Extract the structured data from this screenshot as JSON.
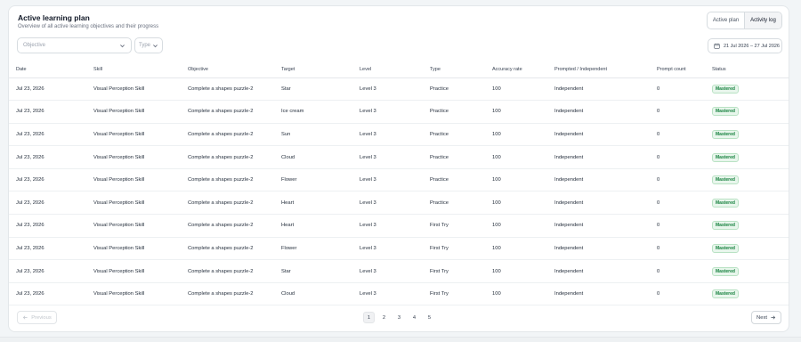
{
  "header": {
    "title": "Active learning plan",
    "subtitle": "Overview of all active learning objectives and their progress"
  },
  "view_toggle": {
    "items": [
      {
        "label": "Active plan",
        "active": false
      },
      {
        "label": "Activity log",
        "active": true
      }
    ]
  },
  "filters": {
    "objective_placeholder": "Objective",
    "type_placeholder": "Type",
    "date_range": "21 Jul 2026 – 27 Jul 2026"
  },
  "table": {
    "columns": [
      "Date",
      "Skill",
      "Objective",
      "Target",
      "Level",
      "Type",
      "Accuracy rate",
      "Prompted / Independent",
      "Prompt count",
      "Status"
    ],
    "rows": [
      [
        "Jul 23, 2026",
        "Visual Perception Skill",
        "Complete a shapes puzzle-2",
        "Star",
        "Level 3",
        "Practice",
        "100",
        "Independent",
        "0",
        "Mastered"
      ],
      [
        "Jul 23, 2026",
        "Visual Perception Skill",
        "Complete a shapes puzzle-2",
        "Ice cream",
        "Level 3",
        "Practice",
        "100",
        "Independent",
        "0",
        "Mastered"
      ],
      [
        "Jul 23, 2026",
        "Visual Perception Skill",
        "Complete a shapes puzzle-2",
        "Sun",
        "Level 3",
        "Practice",
        "100",
        "Independent",
        "0",
        "Mastered"
      ],
      [
        "Jul 23, 2026",
        "Visual Perception Skill",
        "Complete a shapes puzzle-2",
        "Cloud",
        "Level 3",
        "Practice",
        "100",
        "Independent",
        "0",
        "Mastered"
      ],
      [
        "Jul 23, 2026",
        "Visual Perception Skill",
        "Complete a shapes puzzle-2",
        "Flower",
        "Level 3",
        "Practice",
        "100",
        "Independent",
        "0",
        "Mastered"
      ],
      [
        "Jul 23, 2026",
        "Visual Perception Skill",
        "Complete a shapes puzzle-2",
        "Heart",
        "Level 3",
        "Practice",
        "100",
        "Independent",
        "0",
        "Mastered"
      ],
      [
        "Jul 23, 2026",
        "Visual Perception Skill",
        "Complete a shapes puzzle-2",
        "Heart",
        "Level 3",
        "First Try",
        "100",
        "Independent",
        "0",
        "Mastered"
      ],
      [
        "Jul 23, 2026",
        "Visual Perception Skill",
        "Complete a shapes puzzle-2",
        "Flower",
        "Level 3",
        "First Try",
        "100",
        "Independent",
        "0",
        "Mastered"
      ],
      [
        "Jul 23, 2026",
        "Visual Perception Skill",
        "Complete a shapes puzzle-2",
        "Star",
        "Level 3",
        "First Try",
        "100",
        "Independent",
        "0",
        "Mastered"
      ],
      [
        "Jul 23, 2026",
        "Visual Perception Skill",
        "Complete a shapes puzzle-2",
        "Cloud",
        "Level 3",
        "First Try",
        "100",
        "Independent",
        "0",
        "Mastered"
      ]
    ]
  },
  "pagination": {
    "previous_label": "Previous",
    "next_label": "Next",
    "pages": [
      "1",
      "2",
      "3",
      "4",
      "5"
    ],
    "current_page": "1"
  },
  "colors": {
    "status_green": "#15803d",
    "status_bg": "#e8f6ec",
    "border": "#e3e7ea"
  }
}
